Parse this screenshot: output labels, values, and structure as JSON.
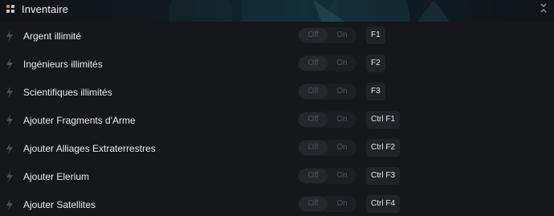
{
  "header": {
    "title": "Inventaire",
    "icon": "grid-icon",
    "collapse_icon": "collapse-chevrons-icon"
  },
  "toggle_labels": {
    "off": "Off",
    "on": "On"
  },
  "rows": [
    {
      "label": "Argent illimité",
      "hotkey": "F1",
      "state": "Off"
    },
    {
      "label": "Ingénieurs illimités",
      "hotkey": "F2",
      "state": "Off"
    },
    {
      "label": "Scientifiques illimités",
      "hotkey": "F3",
      "state": "Off"
    },
    {
      "label": "Ajouter Fragments d'Arme",
      "hotkey": "Ctrl F1",
      "state": "Off"
    },
    {
      "label": "Ajouter Alliages Extraterrestres",
      "hotkey": "Ctrl F2",
      "state": "Off"
    },
    {
      "label": "Ajouter Elerium",
      "hotkey": "Ctrl F3",
      "state": "Off"
    },
    {
      "label": "Ajouter Satellites",
      "hotkey": "Ctrl F4",
      "state": "Off"
    }
  ],
  "colors": {
    "background": "#15171b",
    "accent": "#d8832f"
  }
}
